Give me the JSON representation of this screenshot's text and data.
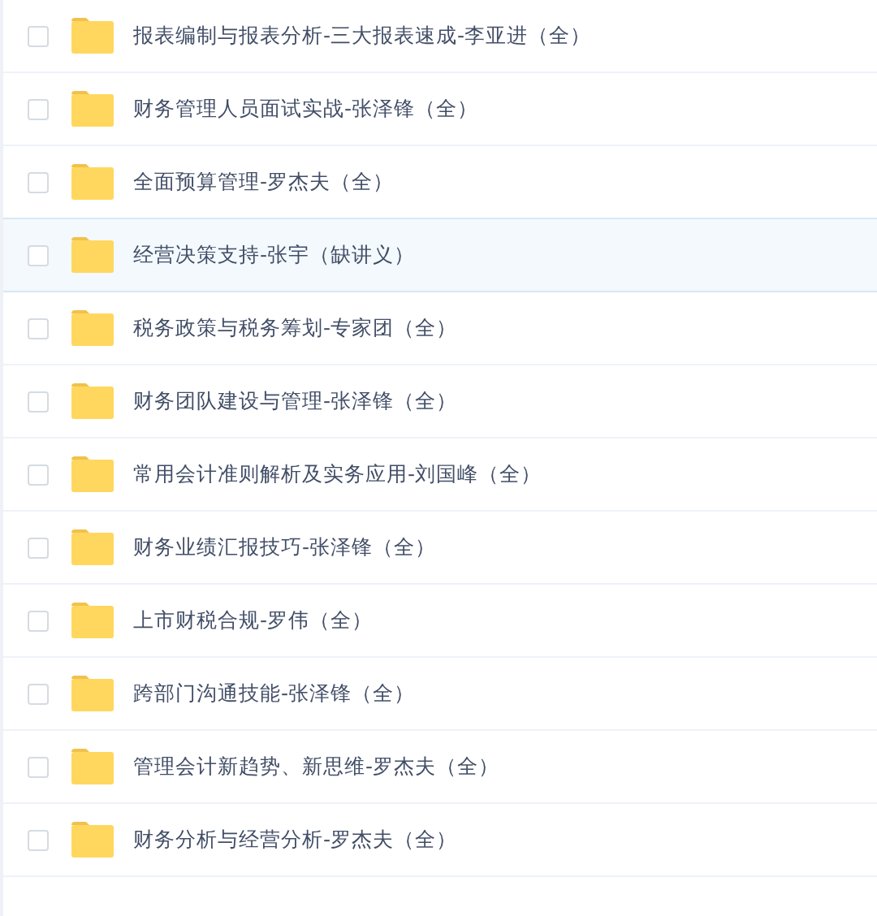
{
  "files": [
    {
      "name": "报表编制与报表分析-三大报表速成-李亚进（全）",
      "selected": false,
      "checked": false
    },
    {
      "name": "财务管理人员面试实战-张泽锋（全）",
      "selected": false,
      "checked": false
    },
    {
      "name": "全面预算管理-罗杰夫（全）",
      "selected": false,
      "checked": false
    },
    {
      "name": "经营决策支持-张宇（缺讲义）",
      "selected": true,
      "checked": false
    },
    {
      "name": "税务政策与税务筹划-专家团（全）",
      "selected": false,
      "checked": false
    },
    {
      "name": "财务团队建设与管理-张泽锋（全）",
      "selected": false,
      "checked": false
    },
    {
      "name": "常用会计准则解析及实务应用-刘国峰（全）",
      "selected": false,
      "checked": false
    },
    {
      "name": "财务业绩汇报技巧-张泽锋（全）",
      "selected": false,
      "checked": false
    },
    {
      "name": "上市财税合规-罗伟（全）",
      "selected": false,
      "checked": false
    },
    {
      "name": "跨部门沟通技能-张泽锋（全）",
      "selected": false,
      "checked": false
    },
    {
      "name": "管理会计新趋势、新思维-罗杰夫（全）",
      "selected": false,
      "checked": false
    },
    {
      "name": "财务分析与经营分析-罗杰夫（全）",
      "selected": false,
      "checked": false
    }
  ]
}
